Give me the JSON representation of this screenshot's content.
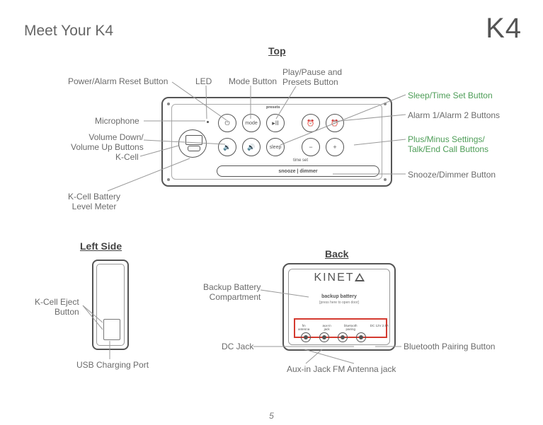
{
  "page": {
    "title": "Meet Your K4",
    "model": "K4",
    "number": "5"
  },
  "sections": {
    "top": "Top",
    "left": "Left Side",
    "back": "Back"
  },
  "top_panel": {
    "presets": "presets",
    "timeset": "time set",
    "snooze_bar": "snooze | dimmer",
    "btn_mode": "mode",
    "btn_sleep": "sleep"
  },
  "callouts": {
    "power_alarm_reset": "Power/Alarm Reset Button",
    "led": "LED",
    "mode": "Mode Button",
    "play_pause_presets": "Play/Pause and\nPresets Button",
    "sleep_time_set": "Sleep/Time Set Button",
    "alarm12": "Alarm 1/Alarm 2 Buttons",
    "plus_minus": "Plus/Minus Settings/\nTalk/End Call Buttons",
    "snooze_dimmer": "Snooze/Dimmer Button",
    "microphone": "Microphone",
    "volume": "Volume Down/\nVolume Up Buttons",
    "kcell": "K-Cell",
    "kcell_battery": "K-Cell Battery\nLevel Meter",
    "kcell_eject": "K-Cell Eject\nButton",
    "usb_port": "USB Charging Port",
    "backup_batt": "Backup Battery\nCompartment",
    "dc_jack": "DC Jack",
    "bt_pairing": "Bluetooth Pairing Button",
    "aux_jack": "Aux-in Jack",
    "fm_antenna": "FM Antenna jack"
  },
  "back_panel": {
    "brand": "KINET",
    "backup": "backup battery",
    "backup_sub": "[press here to open door]",
    "port_fm": "fm\nantenna",
    "port_aux": "aux-in\njack",
    "port_bt": "bluetooth\npairing",
    "port_dc": "DC 12V 2.5A"
  }
}
